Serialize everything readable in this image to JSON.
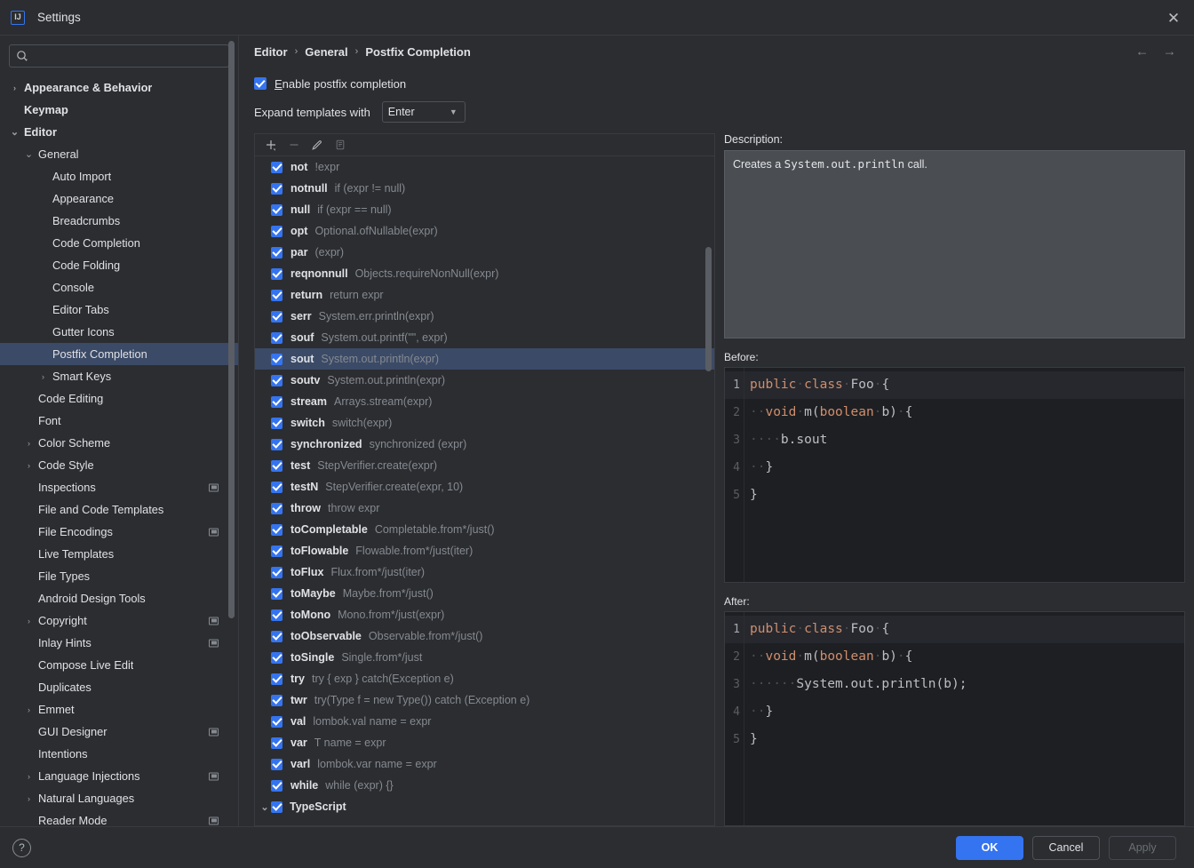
{
  "window": {
    "title": "Settings",
    "app_icon": "intellij-idea-icon",
    "close_icon": "close-icon"
  },
  "sidebar": {
    "search": {
      "placeholder": "",
      "value": "",
      "icon": "search-icon"
    },
    "items": [
      {
        "label": "Appearance & Behavior",
        "indent": 0,
        "chevron": "collapsed",
        "bold": true,
        "badge": false,
        "selected": false
      },
      {
        "label": "Keymap",
        "indent": 0,
        "chevron": "none",
        "bold": true,
        "badge": false,
        "selected": false
      },
      {
        "label": "Editor",
        "indent": 0,
        "chevron": "expanded",
        "bold": true,
        "badge": false,
        "selected": false
      },
      {
        "label": "General",
        "indent": 1,
        "chevron": "expanded",
        "bold": false,
        "badge": false,
        "selected": false
      },
      {
        "label": "Auto Import",
        "indent": 2,
        "chevron": "none",
        "bold": false,
        "badge": false,
        "selected": false
      },
      {
        "label": "Appearance",
        "indent": 2,
        "chevron": "none",
        "bold": false,
        "badge": false,
        "selected": false
      },
      {
        "label": "Breadcrumbs",
        "indent": 2,
        "chevron": "none",
        "bold": false,
        "badge": false,
        "selected": false
      },
      {
        "label": "Code Completion",
        "indent": 2,
        "chevron": "none",
        "bold": false,
        "badge": false,
        "selected": false
      },
      {
        "label": "Code Folding",
        "indent": 2,
        "chevron": "none",
        "bold": false,
        "badge": false,
        "selected": false
      },
      {
        "label": "Console",
        "indent": 2,
        "chevron": "none",
        "bold": false,
        "badge": false,
        "selected": false
      },
      {
        "label": "Editor Tabs",
        "indent": 2,
        "chevron": "none",
        "bold": false,
        "badge": false,
        "selected": false
      },
      {
        "label": "Gutter Icons",
        "indent": 2,
        "chevron": "none",
        "bold": false,
        "badge": false,
        "selected": false
      },
      {
        "label": "Postfix Completion",
        "indent": 2,
        "chevron": "none",
        "bold": false,
        "badge": false,
        "selected": true
      },
      {
        "label": "Smart Keys",
        "indent": 2,
        "chevron": "collapsed",
        "bold": false,
        "badge": false,
        "selected": false
      },
      {
        "label": "Code Editing",
        "indent": 1,
        "chevron": "none",
        "bold": false,
        "badge": false,
        "selected": false
      },
      {
        "label": "Font",
        "indent": 1,
        "chevron": "none",
        "bold": false,
        "badge": false,
        "selected": false
      },
      {
        "label": "Color Scheme",
        "indent": 1,
        "chevron": "collapsed",
        "bold": false,
        "badge": false,
        "selected": false
      },
      {
        "label": "Code Style",
        "indent": 1,
        "chevron": "collapsed",
        "bold": false,
        "badge": false,
        "selected": false
      },
      {
        "label": "Inspections",
        "indent": 1,
        "chevron": "none",
        "bold": false,
        "badge": true,
        "selected": false
      },
      {
        "label": "File and Code Templates",
        "indent": 1,
        "chevron": "none",
        "bold": false,
        "badge": false,
        "selected": false
      },
      {
        "label": "File Encodings",
        "indent": 1,
        "chevron": "none",
        "bold": false,
        "badge": true,
        "selected": false
      },
      {
        "label": "Live Templates",
        "indent": 1,
        "chevron": "none",
        "bold": false,
        "badge": false,
        "selected": false
      },
      {
        "label": "File Types",
        "indent": 1,
        "chevron": "none",
        "bold": false,
        "badge": false,
        "selected": false
      },
      {
        "label": "Android Design Tools",
        "indent": 1,
        "chevron": "none",
        "bold": false,
        "badge": false,
        "selected": false
      },
      {
        "label": "Copyright",
        "indent": 1,
        "chevron": "collapsed",
        "bold": false,
        "badge": true,
        "selected": false
      },
      {
        "label": "Inlay Hints",
        "indent": 1,
        "chevron": "none",
        "bold": false,
        "badge": true,
        "selected": false
      },
      {
        "label": "Compose Live Edit",
        "indent": 1,
        "chevron": "none",
        "bold": false,
        "badge": false,
        "selected": false
      },
      {
        "label": "Duplicates",
        "indent": 1,
        "chevron": "none",
        "bold": false,
        "badge": false,
        "selected": false
      },
      {
        "label": "Emmet",
        "indent": 1,
        "chevron": "collapsed",
        "bold": false,
        "badge": false,
        "selected": false
      },
      {
        "label": "GUI Designer",
        "indent": 1,
        "chevron": "none",
        "bold": false,
        "badge": true,
        "selected": false
      },
      {
        "label": "Intentions",
        "indent": 1,
        "chevron": "none",
        "bold": false,
        "badge": false,
        "selected": false
      },
      {
        "label": "Language Injections",
        "indent": 1,
        "chevron": "collapsed",
        "bold": false,
        "badge": true,
        "selected": false
      },
      {
        "label": "Natural Languages",
        "indent": 1,
        "chevron": "collapsed",
        "bold": false,
        "badge": false,
        "selected": false
      },
      {
        "label": "Reader Mode",
        "indent": 1,
        "chevron": "none",
        "bold": false,
        "badge": true,
        "selected": false
      }
    ]
  },
  "main": {
    "breadcrumb": [
      "Editor",
      "General",
      "Postfix Completion"
    ],
    "breadcrumb_separator": "›",
    "nav_back_icon": "arrow-left-icon",
    "nav_forward_icon": "arrow-right-icon",
    "enable_checkbox": {
      "label": "Enable postfix completion",
      "mnemonic": "E",
      "checked": true
    },
    "expand_with": {
      "label": "Expand templates with",
      "value": "Enter"
    },
    "toolbar": [
      {
        "name": "add-template-button",
        "icon": "plus-icon",
        "enabled": true
      },
      {
        "name": "remove-template-button",
        "icon": "minus-icon",
        "enabled": false
      },
      {
        "name": "edit-template-button",
        "icon": "pencil-icon",
        "enabled": true
      },
      {
        "name": "duplicate-template-button",
        "icon": "copy-icon",
        "enabled": false
      }
    ],
    "templates": [
      {
        "key": "not",
        "desc": "!expr",
        "checked": true,
        "selected": false
      },
      {
        "key": "notnull",
        "desc": "if (expr != null)",
        "checked": true,
        "selected": false
      },
      {
        "key": "null",
        "desc": "if (expr == null)",
        "checked": true,
        "selected": false
      },
      {
        "key": "opt",
        "desc": "Optional.ofNullable(expr)",
        "checked": true,
        "selected": false
      },
      {
        "key": "par",
        "desc": "(expr)",
        "checked": true,
        "selected": false
      },
      {
        "key": "reqnonnull",
        "desc": "Objects.requireNonNull(expr)",
        "checked": true,
        "selected": false
      },
      {
        "key": "return",
        "desc": "return expr",
        "checked": true,
        "selected": false
      },
      {
        "key": "serr",
        "desc": "System.err.println(expr)",
        "checked": true,
        "selected": false
      },
      {
        "key": "souf",
        "desc": "System.out.printf(\"\", expr)",
        "checked": true,
        "selected": false
      },
      {
        "key": "sout",
        "desc": "System.out.println(expr)",
        "checked": true,
        "selected": true
      },
      {
        "key": "soutv",
        "desc": "System.out.println(expr)",
        "checked": true,
        "selected": false
      },
      {
        "key": "stream",
        "desc": "Arrays.stream(expr)",
        "checked": true,
        "selected": false
      },
      {
        "key": "switch",
        "desc": "switch(expr)",
        "checked": true,
        "selected": false
      },
      {
        "key": "synchronized",
        "desc": "synchronized (expr)",
        "checked": true,
        "selected": false
      },
      {
        "key": "test",
        "desc": "StepVerifier.create(expr)",
        "checked": true,
        "selected": false
      },
      {
        "key": "testN",
        "desc": "StepVerifier.create(expr, 10)",
        "checked": true,
        "selected": false
      },
      {
        "key": "throw",
        "desc": "throw expr",
        "checked": true,
        "selected": false
      },
      {
        "key": "toCompletable",
        "desc": "Completable.from*/just()",
        "checked": true,
        "selected": false
      },
      {
        "key": "toFlowable",
        "desc": "Flowable.from*/just(iter)",
        "checked": true,
        "selected": false
      },
      {
        "key": "toFlux",
        "desc": "Flux.from*/just(iter)",
        "checked": true,
        "selected": false
      },
      {
        "key": "toMaybe",
        "desc": "Maybe.from*/just()",
        "checked": true,
        "selected": false
      },
      {
        "key": "toMono",
        "desc": "Mono.from*/just(expr)",
        "checked": true,
        "selected": false
      },
      {
        "key": "toObservable",
        "desc": "Observable.from*/just()",
        "checked": true,
        "selected": false
      },
      {
        "key": "toSingle",
        "desc": "Single.from*/just",
        "checked": true,
        "selected": false
      },
      {
        "key": "try",
        "desc": "try { exp } catch(Exception e)",
        "checked": true,
        "selected": false
      },
      {
        "key": "twr",
        "desc": "try(Type f = new Type()) catch (Exception e)",
        "checked": true,
        "selected": false
      },
      {
        "key": "val",
        "desc": "lombok.val name = expr",
        "checked": true,
        "selected": false
      },
      {
        "key": "var",
        "desc": "T name = expr",
        "checked": true,
        "selected": false
      },
      {
        "key": "varl",
        "desc": "lombok.var name = expr",
        "checked": true,
        "selected": false
      },
      {
        "key": "while",
        "desc": "while (expr) {}",
        "checked": true,
        "selected": false
      }
    ],
    "group_row": {
      "key": "TypeScript",
      "checked": true,
      "chevron": "expanded"
    }
  },
  "details": {
    "description_label": "Description:",
    "description_prefix": "Creates a ",
    "description_code": "System.out.println",
    "description_suffix": " call.",
    "before_label": "Before:",
    "after_label": "After:",
    "before_code": [
      {
        "n": "1",
        "current": true,
        "tokens": [
          {
            "t": "public",
            "c": "kw"
          },
          {
            "t": "·",
            "c": "ws"
          },
          {
            "t": "class",
            "c": "kw"
          },
          {
            "t": "·",
            "c": "ws"
          },
          {
            "t": "Foo",
            "c": "id"
          },
          {
            "t": "·",
            "c": "ws"
          },
          {
            "t": "{",
            "c": "id"
          }
        ]
      },
      {
        "n": "2",
        "current": false,
        "tokens": [
          {
            "t": "··",
            "c": "ws"
          },
          {
            "t": "void",
            "c": "kw"
          },
          {
            "t": "·",
            "c": "ws"
          },
          {
            "t": "m(",
            "c": "id"
          },
          {
            "t": "boolean",
            "c": "kw"
          },
          {
            "t": "·",
            "c": "ws"
          },
          {
            "t": "b)",
            "c": "id"
          },
          {
            "t": "·",
            "c": "ws"
          },
          {
            "t": "{",
            "c": "id"
          }
        ]
      },
      {
        "n": "3",
        "current": false,
        "tokens": [
          {
            "t": "····",
            "c": "ws"
          },
          {
            "t": "b.sout",
            "c": "id"
          }
        ]
      },
      {
        "n": "4",
        "current": false,
        "tokens": [
          {
            "t": "··",
            "c": "ws"
          },
          {
            "t": "}",
            "c": "id"
          }
        ]
      },
      {
        "n": "5",
        "current": false,
        "tokens": [
          {
            "t": "}",
            "c": "id"
          }
        ]
      }
    ],
    "after_code": [
      {
        "n": "1",
        "current": true,
        "tokens": [
          {
            "t": "public",
            "c": "kw"
          },
          {
            "t": "·",
            "c": "ws"
          },
          {
            "t": "class",
            "c": "kw"
          },
          {
            "t": "·",
            "c": "ws"
          },
          {
            "t": "Foo",
            "c": "id"
          },
          {
            "t": "·",
            "c": "ws"
          },
          {
            "t": "{",
            "c": "id"
          }
        ]
      },
      {
        "n": "2",
        "current": false,
        "tokens": [
          {
            "t": "··",
            "c": "ws"
          },
          {
            "t": "void",
            "c": "kw"
          },
          {
            "t": "·",
            "c": "ws"
          },
          {
            "t": "m(",
            "c": "id"
          },
          {
            "t": "boolean",
            "c": "kw"
          },
          {
            "t": "·",
            "c": "ws"
          },
          {
            "t": "b)",
            "c": "id"
          },
          {
            "t": "·",
            "c": "ws"
          },
          {
            "t": "{",
            "c": "id"
          }
        ]
      },
      {
        "n": "3",
        "current": false,
        "tokens": [
          {
            "t": "······",
            "c": "ws"
          },
          {
            "t": "System.out.println(b);",
            "c": "id"
          }
        ]
      },
      {
        "n": "4",
        "current": false,
        "tokens": [
          {
            "t": "··",
            "c": "ws"
          },
          {
            "t": "}",
            "c": "id"
          }
        ]
      },
      {
        "n": "5",
        "current": false,
        "tokens": [
          {
            "t": "}",
            "c": "id"
          }
        ]
      }
    ]
  },
  "footer": {
    "help_icon": "help-icon",
    "ok_label": "OK",
    "cancel_label": "Cancel",
    "apply_label": "Apply",
    "apply_enabled": false
  },
  "colors": {
    "accent": "#3574f0",
    "selection": "#3b4a66",
    "background": "#2b2d30",
    "code_background": "#1e1f22",
    "description_background": "#4a4d51",
    "keyword": "#cf8e6d",
    "muted_text": "#868a91"
  }
}
